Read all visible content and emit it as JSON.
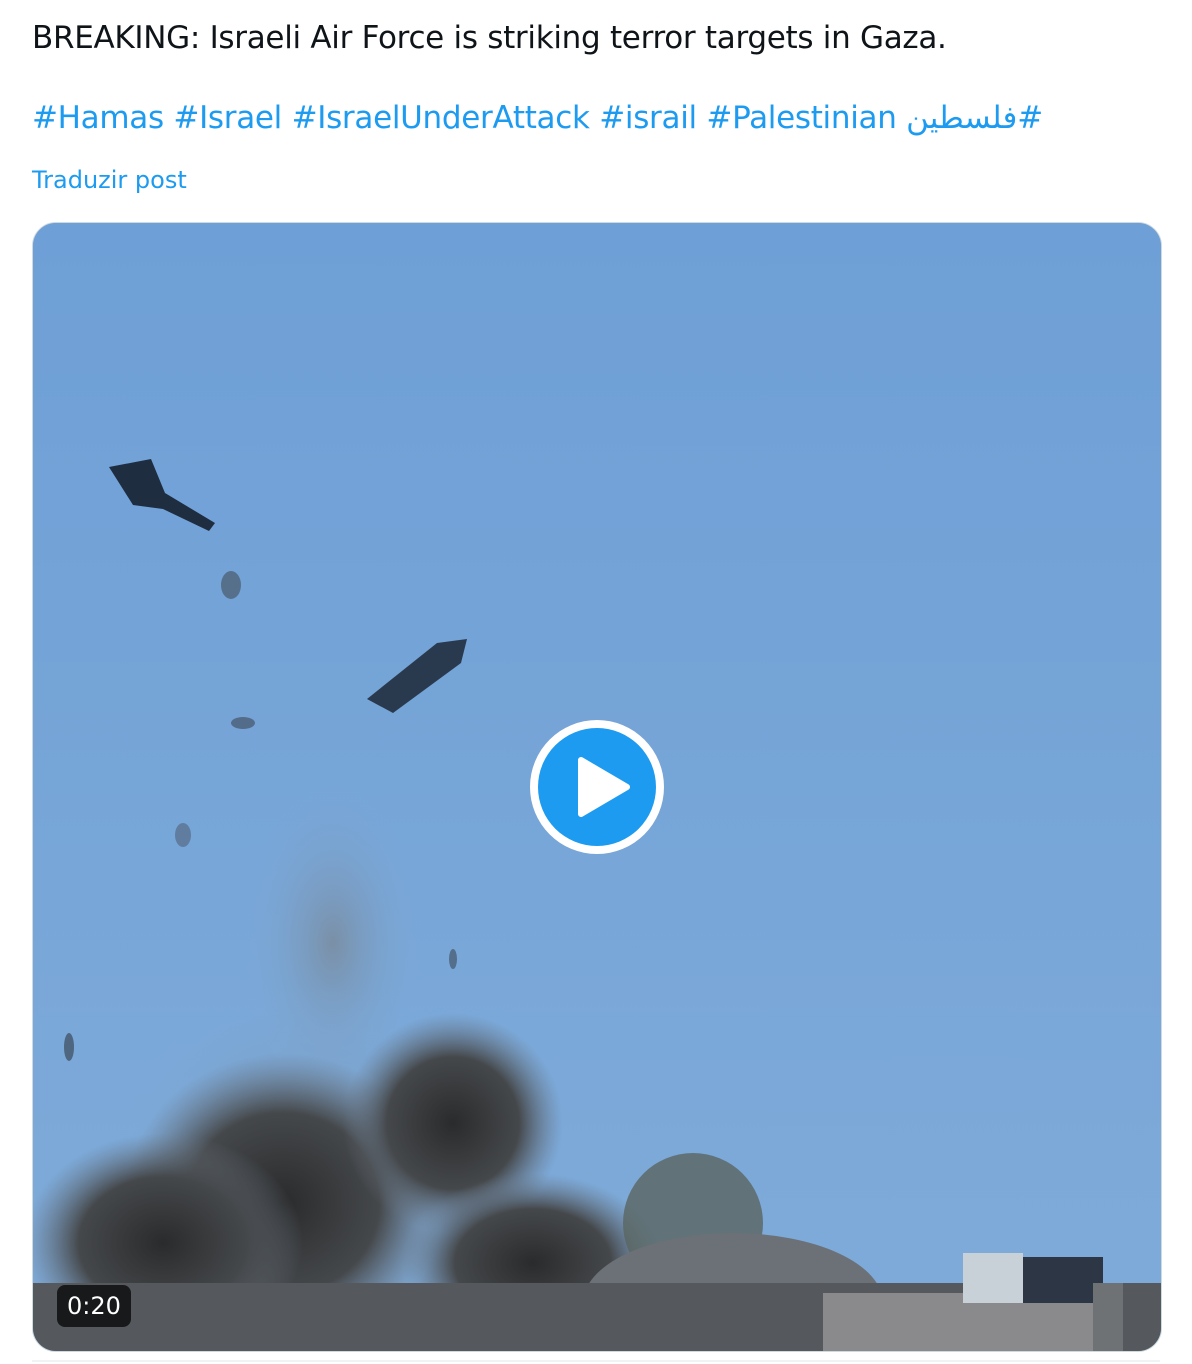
{
  "post": {
    "text": "BREAKING: Israeli Air Force is striking terror targets in Gaza.",
    "hashtags": [
      "#Hamas",
      "#Israel",
      "#IsraelUnderAttack",
      "#israil",
      "#Palestinian",
      "#فلسطين"
    ],
    "translate_label": "Traduzir post"
  },
  "video": {
    "duration": "0:20",
    "play_icon": "play-icon"
  },
  "colors": {
    "link": "#1d9bf0",
    "text": "#0f1419",
    "sky": "#76a4d8"
  }
}
